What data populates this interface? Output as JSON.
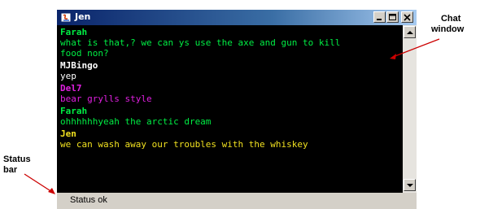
{
  "window": {
    "title": "Jen"
  },
  "chat": {
    "messages": [
      {
        "sender": "Farah",
        "text": "what is that,? we can ys use the axe and gun to kill\nfood non?",
        "color": "#00ee44"
      },
      {
        "sender": "MJBingo",
        "text": "yep",
        "color": "#ffffff"
      },
      {
        "sender": "Del7",
        "text": "bear grylls style",
        "color": "#e020e0"
      },
      {
        "sender": "Farah",
        "text": "ohhhhhhyeah the arctic dream",
        "color": "#00ee44"
      },
      {
        "sender": "Jen",
        "text": "we can wash away our troubles with the whiskey",
        "color": "#f0e020"
      }
    ]
  },
  "status_bar": {
    "text": "Status ok"
  },
  "annotations": {
    "chat_window_line1": "Chat",
    "chat_window_line2": "window",
    "status_bar_line1": "Status",
    "status_bar_line2": "bar",
    "arrow_color": "#cc0000"
  }
}
